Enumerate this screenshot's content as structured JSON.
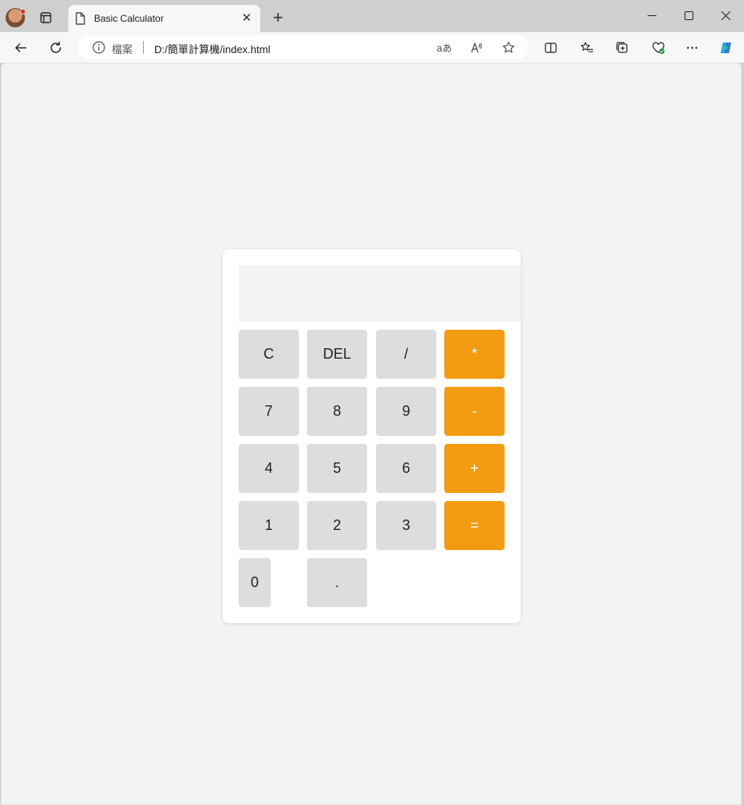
{
  "browser": {
    "tab_title": "Basic Calculator",
    "tab_close": "✕",
    "new_tab": "+",
    "address_label": "檔案",
    "url": "D:/簡單計算機/index.html",
    "translate_label": "aあ"
  },
  "calculator": {
    "display": "",
    "keys": {
      "clear": "C",
      "del": "DEL",
      "divide": "/",
      "multiply": "*",
      "seven": "7",
      "eight": "8",
      "nine": "9",
      "minus": "-",
      "four": "4",
      "five": "5",
      "six": "6",
      "plus": "+",
      "one": "1",
      "two": "2",
      "three": "3",
      "equals": "=",
      "zero": "0",
      "dot": "."
    }
  },
  "colors": {
    "operator": "#f39c12",
    "key": "#dddddd",
    "page_background": "#f3f3f3"
  }
}
